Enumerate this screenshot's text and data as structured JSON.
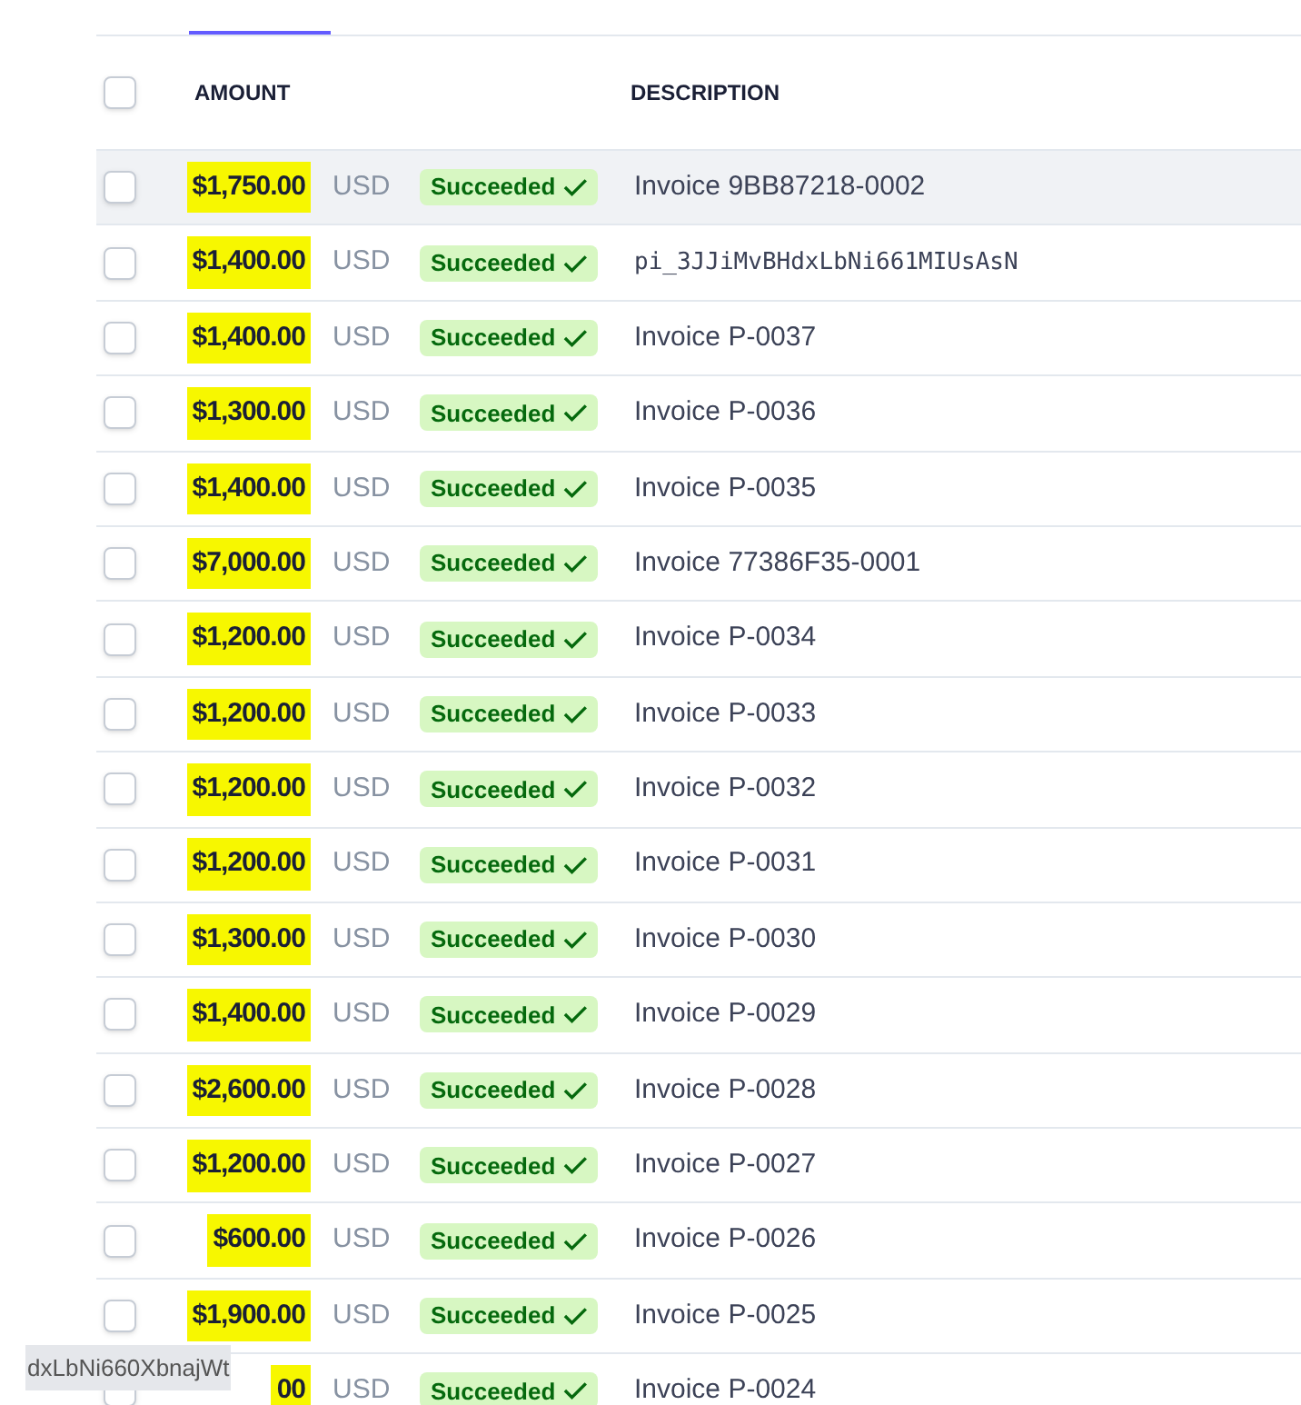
{
  "table": {
    "columns": [
      "AMOUNT",
      "DESCRIPTION"
    ],
    "header_checkbox": {
      "checked": false
    },
    "rows": [
      {
        "checked": false,
        "amount": "$1,750.00",
        "currency": "USD",
        "status": "Succeeded",
        "description": "Invoice 9BB87218-0002",
        "kind": "text",
        "hovered": true,
        "highlighted": true
      },
      {
        "checked": false,
        "amount": "$1,400.00",
        "currency": "USD",
        "status": "Succeeded",
        "description": "pi_3JJiMvBHdxLbNi661MIUsAsN",
        "kind": "code",
        "hovered": false,
        "highlighted": true
      },
      {
        "checked": false,
        "amount": "$1,400.00",
        "currency": "USD",
        "status": "Succeeded",
        "description": "Invoice P-0037",
        "kind": "text",
        "hovered": false,
        "highlighted": true
      },
      {
        "checked": false,
        "amount": "$1,300.00",
        "currency": "USD",
        "status": "Succeeded",
        "description": "Invoice P-0036",
        "kind": "text",
        "hovered": false,
        "highlighted": true
      },
      {
        "checked": false,
        "amount": "$1,400.00",
        "currency": "USD",
        "status": "Succeeded",
        "description": "Invoice P-0035",
        "kind": "text",
        "hovered": false,
        "highlighted": true
      },
      {
        "checked": false,
        "amount": "$7,000.00",
        "currency": "USD",
        "status": "Succeeded",
        "description": "Invoice 77386F35-0001",
        "kind": "text",
        "hovered": false,
        "highlighted": true
      },
      {
        "checked": false,
        "amount": "$1,200.00",
        "currency": "USD",
        "status": "Succeeded",
        "description": "Invoice P-0034",
        "kind": "text",
        "hovered": false,
        "highlighted": true
      },
      {
        "checked": false,
        "amount": "$1,200.00",
        "currency": "USD",
        "status": "Succeeded",
        "description": "Invoice P-0033",
        "kind": "text",
        "hovered": false,
        "highlighted": true
      },
      {
        "checked": false,
        "amount": "$1,200.00",
        "currency": "USD",
        "status": "Succeeded",
        "description": "Invoice P-0032",
        "kind": "text",
        "hovered": false,
        "highlighted": true
      },
      {
        "checked": false,
        "amount": "$1,200.00",
        "currency": "USD",
        "status": "Succeeded",
        "description": "Invoice P-0031",
        "kind": "text",
        "hovered": false,
        "highlighted": true
      },
      {
        "checked": false,
        "amount": "$1,300.00",
        "currency": "USD",
        "status": "Succeeded",
        "description": "Invoice P-0030",
        "kind": "text",
        "hovered": false,
        "highlighted": true
      },
      {
        "checked": false,
        "amount": "$1,400.00",
        "currency": "USD",
        "status": "Succeeded",
        "description": "Invoice P-0029",
        "kind": "text",
        "hovered": false,
        "highlighted": true
      },
      {
        "checked": false,
        "amount": "$2,600.00",
        "currency": "USD",
        "status": "Succeeded",
        "description": "Invoice P-0028",
        "kind": "text",
        "hovered": false,
        "highlighted": true
      },
      {
        "checked": false,
        "amount": "$1,200.00",
        "currency": "USD",
        "status": "Succeeded",
        "description": "Invoice P-0027",
        "kind": "text",
        "hovered": false,
        "highlighted": true
      },
      {
        "checked": false,
        "amount": "$600.00",
        "currency": "USD",
        "status": "Succeeded",
        "description": "Invoice P-0026",
        "kind": "text",
        "hovered": false,
        "highlighted": true
      },
      {
        "checked": false,
        "amount": "$1,900.00",
        "currency": "USD",
        "status": "Succeeded",
        "description": "Invoice P-0025",
        "kind": "text",
        "hovered": false,
        "highlighted": true
      },
      {
        "checked": false,
        "amount": "00",
        "currency": "USD",
        "status": "Succeeded",
        "description": "Invoice P-0024",
        "kind": "text",
        "hovered": false,
        "highlighted": true
      }
    ]
  },
  "tooltip": {
    "text": "dxLbNi660XbnajWt"
  }
}
